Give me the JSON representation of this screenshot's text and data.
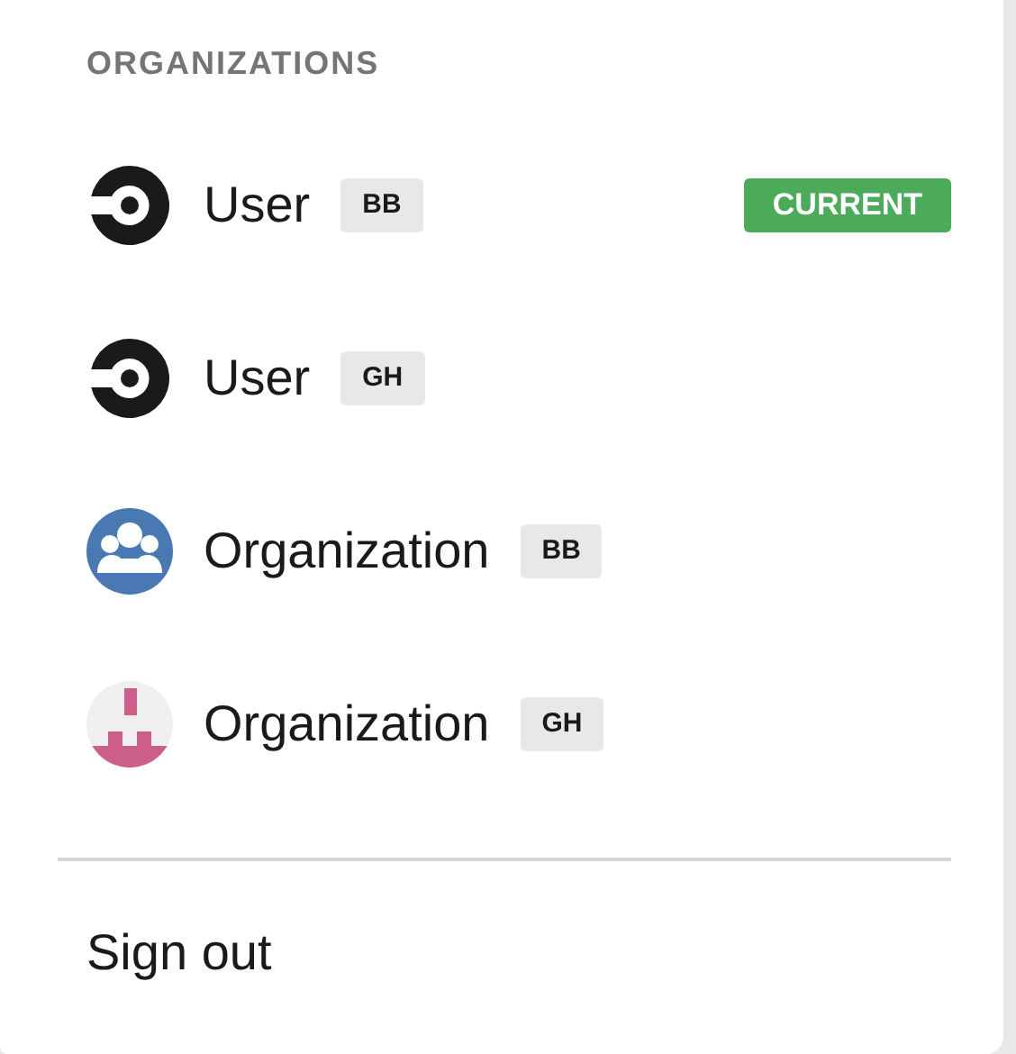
{
  "section_heading": "ORGANIZATIONS",
  "current_label": "CURRENT",
  "organizations": [
    {
      "name": "User",
      "vcs": "BB",
      "kind": "ring",
      "current": true
    },
    {
      "name": "User",
      "vcs": "GH",
      "kind": "ring",
      "current": false
    },
    {
      "name": "Organization",
      "vcs": "BB",
      "kind": "group",
      "current": false
    },
    {
      "name": "Organization",
      "vcs": "GH",
      "kind": "identicon",
      "current": false
    }
  ],
  "sign_out": "Sign out"
}
